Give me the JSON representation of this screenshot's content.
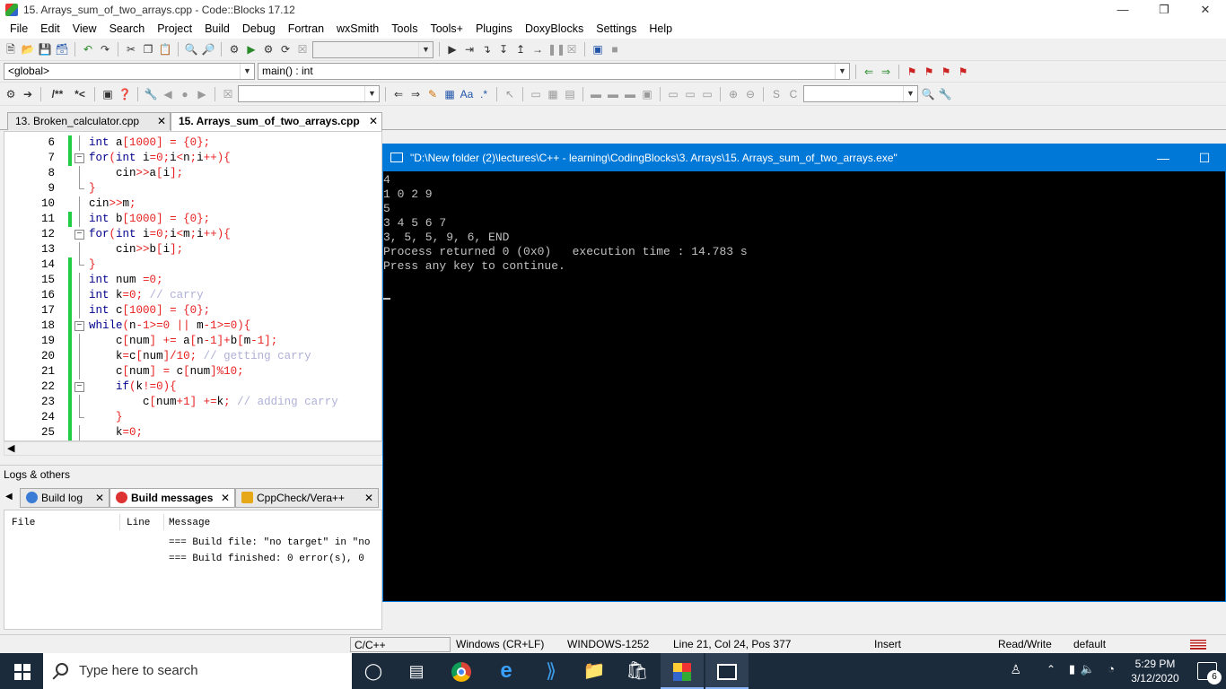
{
  "window": {
    "title": "15. Arrays_sum_of_two_arrays.cpp - Code::Blocks 17.12"
  },
  "menu": [
    "File",
    "Edit",
    "View",
    "Search",
    "Project",
    "Build",
    "Debug",
    "Fortran",
    "wxSmith",
    "Tools",
    "Tools+",
    "Plugins",
    "DoxyBlocks",
    "Settings",
    "Help"
  ],
  "toolbar": {
    "scope": "<global>",
    "function": "main() : int",
    "doxy_comment": "/**",
    "doxy_line": "*<"
  },
  "tabs": [
    {
      "label": "13. Broken_calculator.cpp",
      "active": false
    },
    {
      "label": "15. Arrays_sum_of_two_arrays.cpp",
      "active": true
    }
  ],
  "editor": {
    "lines": [
      {
        "n": "6",
        "fold": "line",
        "chg": true,
        "html": "<span class='kw'>int</span> a<span class='op'>[</span><span class='num'>1000</span><span class='op'>]</span> <span class='op'>=</span> <span class='op'>{</span><span class='num'>0</span><span class='op'>};</span>"
      },
      {
        "n": "7",
        "fold": "box",
        "chg": true,
        "html": "<span class='kw'>for</span><span class='op'>(</span><span class='kw'>int</span> i<span class='op'>=</span><span class='num'>0</span><span class='op'>;</span>i<span class='op'>&lt;</span>n<span class='op'>;</span>i<span class='op'>++){</span>"
      },
      {
        "n": "8",
        "fold": "line",
        "chg": false,
        "html": "    cin<span class='op'>&gt;&gt;</span>a<span class='op'>[</span>i<span class='op'>];</span>"
      },
      {
        "n": "9",
        "fold": "end",
        "chg": false,
        "html": "<span class='op'>}</span>"
      },
      {
        "n": "10",
        "fold": "line",
        "chg": false,
        "html": "cin<span class='op'>&gt;&gt;</span>m<span class='op'>;</span>"
      },
      {
        "n": "11",
        "fold": "line",
        "chg": true,
        "html": "<span class='kw'>int</span> b<span class='op'>[</span><span class='num'>1000</span><span class='op'>]</span> <span class='op'>=</span> <span class='op'>{</span><span class='num'>0</span><span class='op'>};</span>"
      },
      {
        "n": "12",
        "fold": "box",
        "chg": false,
        "html": "<span class='kw'>for</span><span class='op'>(</span><span class='kw'>int</span> i<span class='op'>=</span><span class='num'>0</span><span class='op'>;</span>i<span class='op'>&lt;</span>m<span class='op'>;</span>i<span class='op'>++){</span>"
      },
      {
        "n": "13",
        "fold": "line",
        "chg": false,
        "html": "    cin<span class='op'>&gt;&gt;</span>b<span class='op'>[</span>i<span class='op'>];</span>"
      },
      {
        "n": "14",
        "fold": "end",
        "chg": true,
        "html": "<span class='op'>}</span>"
      },
      {
        "n": "15",
        "fold": "line",
        "chg": true,
        "html": "<span class='kw'>int</span> num <span class='op'>=</span><span class='num'>0</span><span class='op'>;</span>"
      },
      {
        "n": "16",
        "fold": "line",
        "chg": true,
        "html": "<span class='kw'>int</span> k<span class='op'>=</span><span class='num'>0</span><span class='op'>;</span> <span class='cm'>// carry</span>"
      },
      {
        "n": "17",
        "fold": "line",
        "chg": true,
        "html": "<span class='kw'>int</span> c<span class='op'>[</span><span class='num'>1000</span><span class='op'>]</span> <span class='op'>=</span> <span class='op'>{</span><span class='num'>0</span><span class='op'>};</span>"
      },
      {
        "n": "18",
        "fold": "box",
        "chg": true,
        "html": "<span class='kw'>while</span><span class='op'>(</span>n<span class='op'>-</span><span class='num'>1</span><span class='op'>&gt;=</span><span class='num'>0</span> <span class='op'>||</span> m<span class='op'>-</span><span class='num'>1</span><span class='op'>&gt;=</span><span class='num'>0</span><span class='op'>){</span>"
      },
      {
        "n": "19",
        "fold": "line",
        "chg": true,
        "html": "    c<span class='op'>[</span>num<span class='op'>]</span> <span class='op'>+=</span> a<span class='op'>[</span>n<span class='op'>-</span><span class='num'>1</span><span class='op'>]+</span>b<span class='op'>[</span>m<span class='op'>-</span><span class='num'>1</span><span class='op'>];</span>"
      },
      {
        "n": "20",
        "fold": "line",
        "chg": true,
        "html": "    k<span class='op'>=</span>c<span class='op'>[</span>num<span class='op'>]/</span><span class='num'>10</span><span class='op'>;</span> <span class='cm'>// getting carry</span>"
      },
      {
        "n": "21",
        "fold": "line",
        "chg": true,
        "html": "    c<span class='op'>[</span>num<span class='op'>]</span> <span class='op'>=</span> c<span class='op'>[</span>num<span class='op'>]%</span><span class='num'>10</span><span class='op'>;</span>"
      },
      {
        "n": "22",
        "fold": "box",
        "chg": true,
        "html": "    <span class='kw'>if</span><span class='op'>(</span>k<span class='op'>!=</span><span class='num'>0</span><span class='op'>){</span>"
      },
      {
        "n": "23",
        "fold": "line",
        "chg": true,
        "html": "        c<span class='op'>[</span>num<span class='op'>+</span><span class='num'>1</span><span class='op'>]</span> <span class='op'>+=</span>k<span class='op'>;</span> <span class='cm'>// adding carry</span>"
      },
      {
        "n": "24",
        "fold": "end",
        "chg": true,
        "html": "    <span class='op'>}</span>"
      },
      {
        "n": "25",
        "fold": "line",
        "chg": true,
        "html": "    k<span class='op'>=</span><span class='num'>0</span><span class='op'>;</span>"
      }
    ]
  },
  "logs": {
    "title": "Logs & others",
    "tabs": [
      {
        "label": "Build log",
        "active": false
      },
      {
        "label": "Build messages",
        "active": true
      },
      {
        "label": "CppCheck/Vera++",
        "active": false
      }
    ],
    "columns": [
      "File",
      "Line",
      "Message"
    ],
    "messages": [
      "=== Build file: \"no target\" in \"no",
      "=== Build finished: 0 error(s), 0"
    ]
  },
  "console": {
    "title": "\"D:\\New folder (2)\\lectures\\C++ - learning\\CodingBlocks\\3. Arrays\\15. Arrays_sum_of_two_arrays.exe\"",
    "lines": [
      "4",
      "1 0 2 9",
      "5",
      "3 4 5 6 7",
      "3, 5, 5, 9, 6, END",
      "Process returned 0 (0x0)   execution time : 14.783 s",
      "Press any key to continue."
    ]
  },
  "status": {
    "language": "C/C++",
    "eol": "Windows (CR+LF)",
    "encoding": "WINDOWS-1252",
    "position": "Line 21, Col 24, Pos 377",
    "mode": "Insert",
    "rw": "Read/Write",
    "profile": "default"
  },
  "taskbar": {
    "search_placeholder": "Type here to search",
    "time": "5:29 PM",
    "date": "3/12/2020",
    "notifications": "6"
  }
}
